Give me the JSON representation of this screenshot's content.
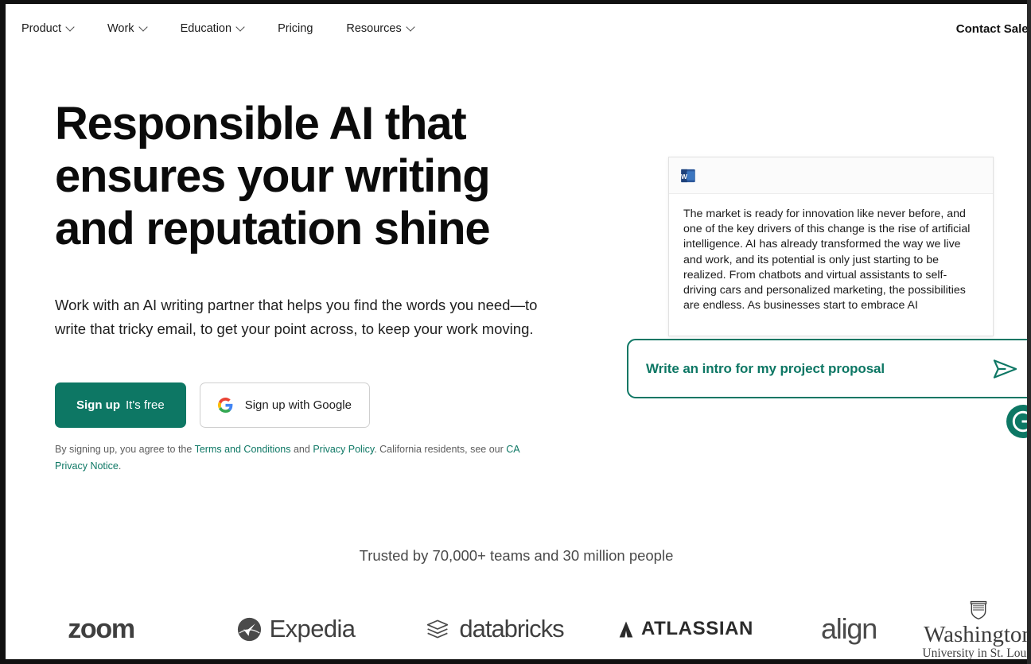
{
  "nav": {
    "items": [
      {
        "label": "Product",
        "has_dropdown": true,
        "icon": "chevron-down-icon"
      },
      {
        "label": "Work",
        "has_dropdown": true,
        "icon": "chevron-down-icon"
      },
      {
        "label": "Education",
        "has_dropdown": true,
        "icon": "chevron-down-icon"
      },
      {
        "label": "Pricing",
        "has_dropdown": false,
        "icon": ""
      },
      {
        "label": "Resources",
        "has_dropdown": true,
        "icon": "chevron-down-icon"
      }
    ],
    "contact_label": "Contact Sales"
  },
  "hero": {
    "headline": "Responsible AI that ensures your writing and reputation shine",
    "subcopy": "Work with an AI writing partner that helps you find the words you need—to write that tricky email, to get your point across, to keep your work moving.",
    "signup_strong": "Sign up",
    "signup_light": "It's free",
    "google_label": "Sign up with Google",
    "google_icon": "google-g-icon",
    "legal_prefix": "By signing up, you agree to the ",
    "legal_link_terms": "Terms and Conditions",
    "legal_mid": " and ",
    "legal_link_privacy": "Privacy Policy",
    "legal_mid2": ". California residents, see our ",
    "legal_link_ca": "CA Privacy Notice",
    "legal_suffix": "."
  },
  "doc_mockup": {
    "app_icon": "microsoft-word-icon",
    "body_text": "The market is ready for innovation like never before, and one of the key drivers of this change is the rise of artificial intelligence. AI has already transformed the way we live and work, and its potential is only just starting to be realized. From chatbots and virtual assistants to self-driving cars and personalized marketing, the possibilities are endless. As businesses start to embrace AI"
  },
  "prompt": {
    "text": "Write an intro for my project proposal",
    "send_icon": "paper-plane-send-icon",
    "badge_icon": "grammarly-g-icon"
  },
  "social_proof": {
    "trusted_text": "Trusted by 70,000+ teams and 30 million people",
    "logos": [
      {
        "name": "zoom",
        "label": "zoom"
      },
      {
        "name": "expedia",
        "label": "Expedia"
      },
      {
        "name": "databricks",
        "label": "databricks"
      },
      {
        "name": "atlassian",
        "label": "ATLASSIAN"
      },
      {
        "name": "align",
        "label": "align"
      },
      {
        "name": "wustl",
        "label": "Washington",
        "sublabel": "University in St. Louis"
      }
    ]
  },
  "colors": {
    "brand_green": "#0d7764",
    "text_dark": "#0b0b0b",
    "muted": "#5d5d5d",
    "word_blue": "#2b579a"
  }
}
